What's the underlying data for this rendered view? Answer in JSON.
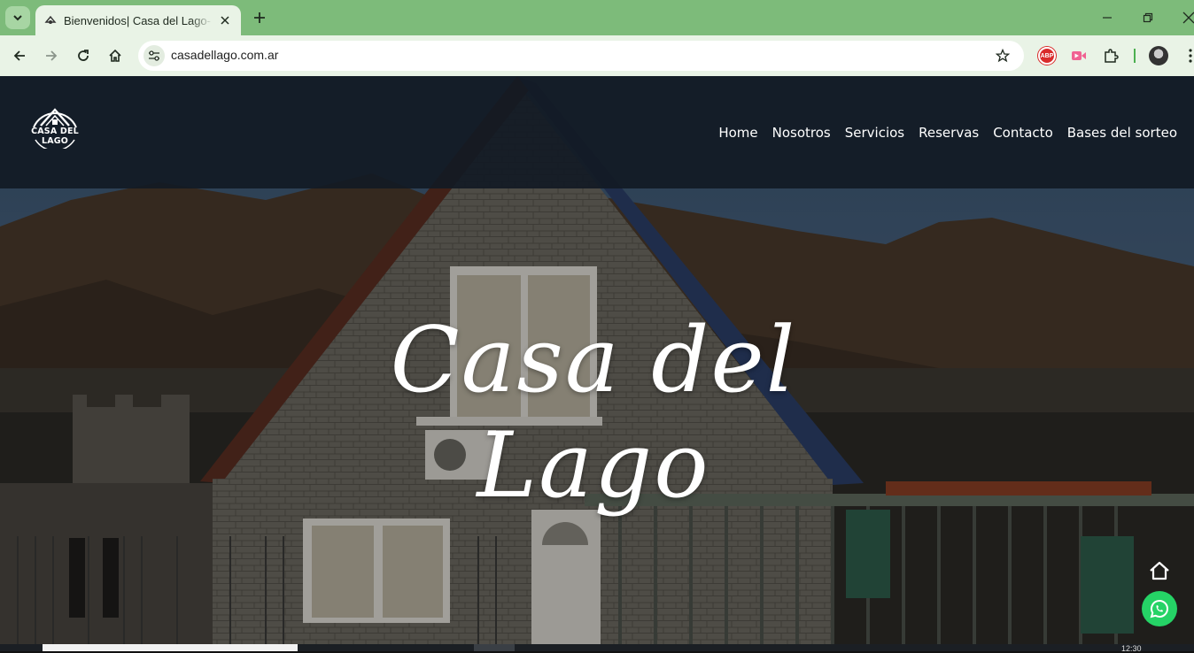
{
  "browser": {
    "tab_title": "Bienvenidos| Casa del Lago- Ca",
    "url": "casadellago.com.ar",
    "abp_label": "ABP"
  },
  "site": {
    "logo_text": "CASA DEL LAGO",
    "nav": [
      "Home",
      "Nosotros",
      "Servicios",
      "Reservas",
      "Contacto",
      "Bases del sorteo"
    ],
    "hero_title": "Casa del Lago"
  },
  "taskbar": {
    "clock": "12:30"
  },
  "colors": {
    "tabbar": "#7dbb7a",
    "toolbar": "#e9f3e6",
    "header_overlay": "#121a24",
    "whatsapp": "#25d366"
  },
  "icons": [
    "tab-search-icon",
    "favicon-icon",
    "close-icon",
    "plus-icon",
    "minimize-icon",
    "restore-icon",
    "back-icon",
    "forward-icon",
    "reload-icon",
    "home-icon",
    "tune-icon",
    "star-icon",
    "extension-icon",
    "puzzle-icon",
    "whatsapp-icon"
  ]
}
